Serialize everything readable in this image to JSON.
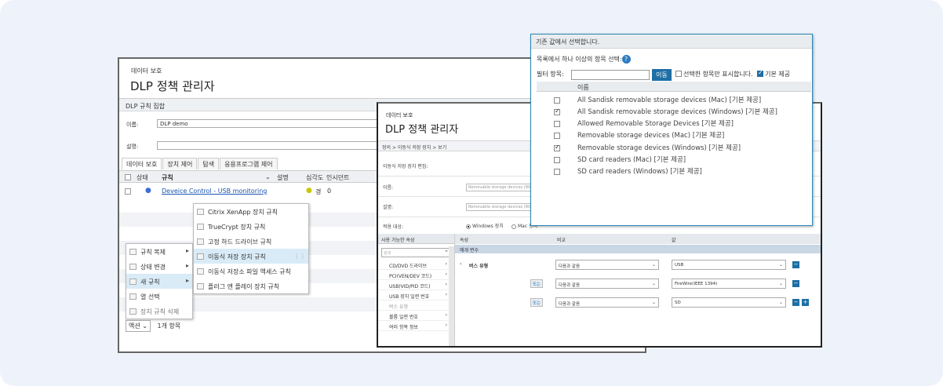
{
  "colors": {
    "accent": "#1d6ea5",
    "link": "#1a55b0",
    "highlight": "#d9ebf7",
    "background": "#eef3fb"
  },
  "policy_window": {
    "subtitle": "데이터 보호",
    "title": "DLP 정책 관리자",
    "group_header": "DLP 규칙 집합",
    "name_label": "이름:",
    "name_value": "DLP demo",
    "desc_label": "설명:",
    "tabs": [
      {
        "label": "데이터 보호",
        "active": true
      },
      {
        "label": "장치 제어",
        "active": false
      },
      {
        "label": "탐색",
        "active": false
      },
      {
        "label": "응용프로그램 제어",
        "active": false
      }
    ],
    "columns": {
      "status": "상태",
      "rule": "규칙",
      "description": "설명",
      "severity": "심각도",
      "incident": "인시던트"
    },
    "row": {
      "rule": "Deveice Control - USB monitoring",
      "severity": "경",
      "incident": "0"
    },
    "context_menu": [
      {
        "label": "규칙 복제",
        "has_sub": true,
        "highlighted": false,
        "disabled": false
      },
      {
        "label": "상태 변경",
        "has_sub": true,
        "highlighted": false,
        "disabled": false
      },
      {
        "label": "새 규칙",
        "has_sub": true,
        "highlighted": true,
        "disabled": false
      },
      {
        "label": "열 선택",
        "has_sub": false,
        "highlighted": false,
        "disabled": false
      },
      {
        "label": "장치 규칙 삭제",
        "has_sub": false,
        "highlighted": false,
        "disabled": true
      }
    ],
    "submenu": [
      {
        "label": "Citrix XenApp 장치 규칙",
        "highlighted": false
      },
      {
        "label": "TrueCrypt 장치 규칙",
        "highlighted": false
      },
      {
        "label": "고정 하드 드라이브 규칙",
        "highlighted": false
      },
      {
        "label": "이동식 저장 장치 규칙",
        "highlighted": true
      },
      {
        "label": "이동식 저장소 파일 액세스 규칙",
        "highlighted": false
      },
      {
        "label": "플러그 앤 플레이 장치 규칙",
        "highlighted": false
      }
    ],
    "footer_action": "액션",
    "footer_count": "1개 항목"
  },
  "device_window": {
    "subtitle": "데이터 보호",
    "title": "DLP 정책 관리자",
    "breadcrumb": "정의 > 이동식 저장 장치 > 보기",
    "edit_label": "이동식 저장 장치 편집:",
    "name_label": "이름:",
    "name_placeholder": "Removable storage devices (Wi",
    "desc_label": "설명:",
    "desc_placeholder": "Removable storage devices (Wi",
    "apply_label": "적용 대상:",
    "radio_windows": "Windows 장치",
    "radio_mac": "Mac 장치",
    "left_header": "사용 가능한 속성",
    "search_placeholder": "검색",
    "properties": [
      {
        "label": "CD/DVD 드라이브",
        "disabled": false
      },
      {
        "label": "PCI(VEN/DEV 코드)",
        "disabled": false
      },
      {
        "label": "USB(VID/PID 코드)",
        "disabled": false
      },
      {
        "label": "USB 장치 일련 번호",
        "disabled": false
      },
      {
        "label": "버스 유형",
        "disabled": true
      },
      {
        "label": "볼륨 일련 번호",
        "disabled": false
      },
      {
        "label": "여러 항목 정보",
        "disabled": false
      }
    ],
    "right_headers": {
      "attribute": "속성",
      "comparison": "비교",
      "value": "값"
    },
    "param_band": "매개 변수",
    "condition_attr": "버스 유형",
    "or_label": "또는",
    "conditions": [
      {
        "comparison": "다음과 같음",
        "value": "USB"
      },
      {
        "comparison": "다음과 같음",
        "value": "FireWire(IEEE 1394)"
      },
      {
        "comparison": "다음과 같음",
        "value": "SD"
      }
    ]
  },
  "select_dialog": {
    "header": "기존 값에서 선택합니다.",
    "prompt": "목록에서 하나 이상의 항목 선택:",
    "filter_label": "필터 항목:",
    "filter_value": "",
    "filter_button": "이동",
    "show_selected": "선택한 항목만 표시합니다.",
    "default_provided": "기본 제공",
    "list_header": "이름",
    "items": [
      {
        "label": "All Sandisk removable storage devices (Mac) [기본 제공]",
        "checked": false
      },
      {
        "label": "All Sandisk removable storage devices (Windows) [기본 제공]",
        "checked": true
      },
      {
        "label": "Allowed Removable Storage Devices [기본 제공]",
        "checked": false
      },
      {
        "label": "Removable storage devices (Mac) [기본 제공]",
        "checked": false
      },
      {
        "label": "Removable storage devices (Windows) [기본 제공]",
        "checked": true
      },
      {
        "label": "SD card readers (Mac) [기본 제공]",
        "checked": false
      },
      {
        "label": "SD card readers (Windows) [기본 제공]",
        "checked": false
      }
    ]
  }
}
